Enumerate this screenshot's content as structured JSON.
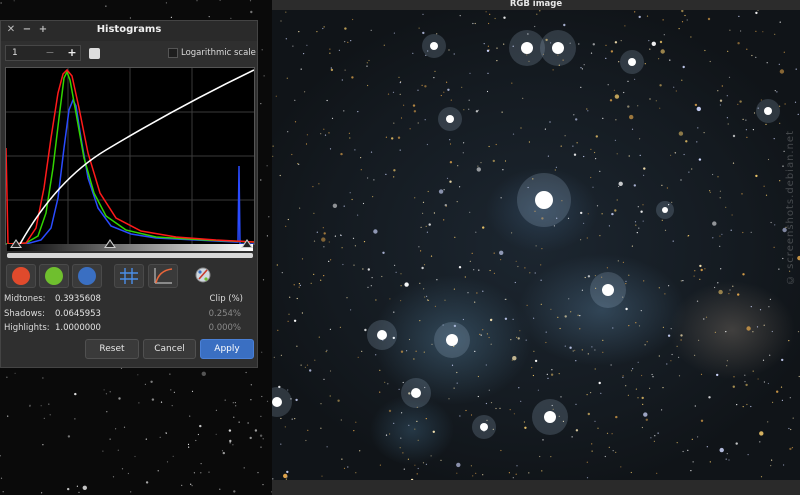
{
  "histogram_dialog": {
    "title": "Histograms",
    "zoom_value": "1",
    "minus_label": "−",
    "plus_label": "+",
    "log_scale_label": "Logarithmic scale",
    "clip_header": "Clip (%)",
    "midtones_label": "Midtones:",
    "midtones_value": "0.3935608",
    "shadows_label": "Shadows:",
    "shadows_value": "0.0645953",
    "shadows_clip": "0.254%",
    "highlights_label": "Highlights:",
    "highlights_value": "1.0000000",
    "highlights_clip": "0.000%",
    "reset_label": "Reset",
    "cancel_label": "Cancel",
    "apply_label": "Apply",
    "colors": {
      "red": "#e04a2c",
      "green": "#6fbf2e",
      "blue": "#3a6fc2"
    }
  },
  "rgb_window": {
    "title": "RGB image",
    "watermark": "© screenshots.debian.net"
  }
}
